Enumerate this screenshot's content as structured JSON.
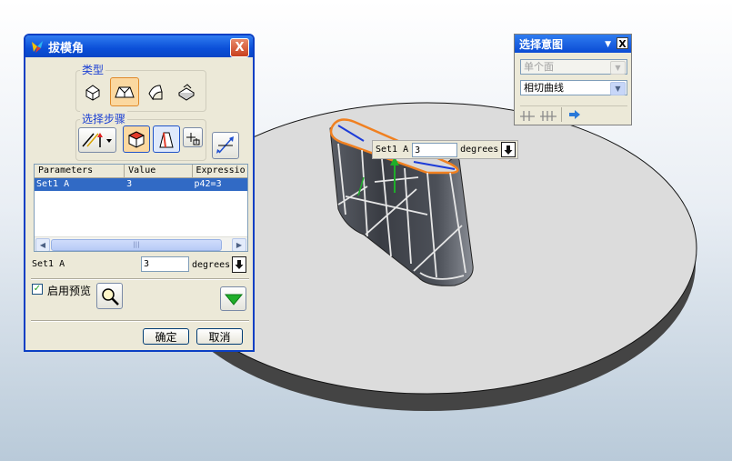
{
  "dialog": {
    "title": "拔模角",
    "close_label": "X",
    "type_group": {
      "label": "类型",
      "icons": [
        "draft-from-plane-icon",
        "draft-from-edges-icon",
        "draft-tangent-faces-icon",
        "draft-parting-edge-icon"
      ]
    },
    "steps_group": {
      "label": "选择步骤",
      "icons": [
        "draft-direction-icon",
        "fixed-plane-icon",
        "draft-faces-icon",
        "point-constructor-icon",
        "reverse-direction-icon"
      ]
    },
    "table": {
      "columns": [
        "Parameters",
        "Value",
        "Expressio"
      ],
      "rows": [
        [
          "Set1 A",
          "3",
          "p42=3"
        ]
      ],
      "scroll_grip": "|||"
    },
    "param_label": "Set1 A",
    "param_value": "3",
    "param_unit": "degrees",
    "preview_label": "启用预览",
    "preview_checked": true,
    "ok_label": "确定",
    "cancel_label": "取消"
  },
  "selection_intent": {
    "title": "选择意图",
    "close_label": "X",
    "face_rule": "单个面",
    "curve_rule": "相切曲线"
  },
  "on_graphics": {
    "label": "Set1 A",
    "value": "3",
    "unit": "degrees"
  },
  "colors": {
    "title_bar": "#0b4fd8",
    "dialog_bg": "#ece9d8",
    "selected_row": "#316ac5",
    "highlight_edge": "#f08020",
    "part_body": "#4a4e56",
    "base_disc": "#dcdcdc"
  }
}
